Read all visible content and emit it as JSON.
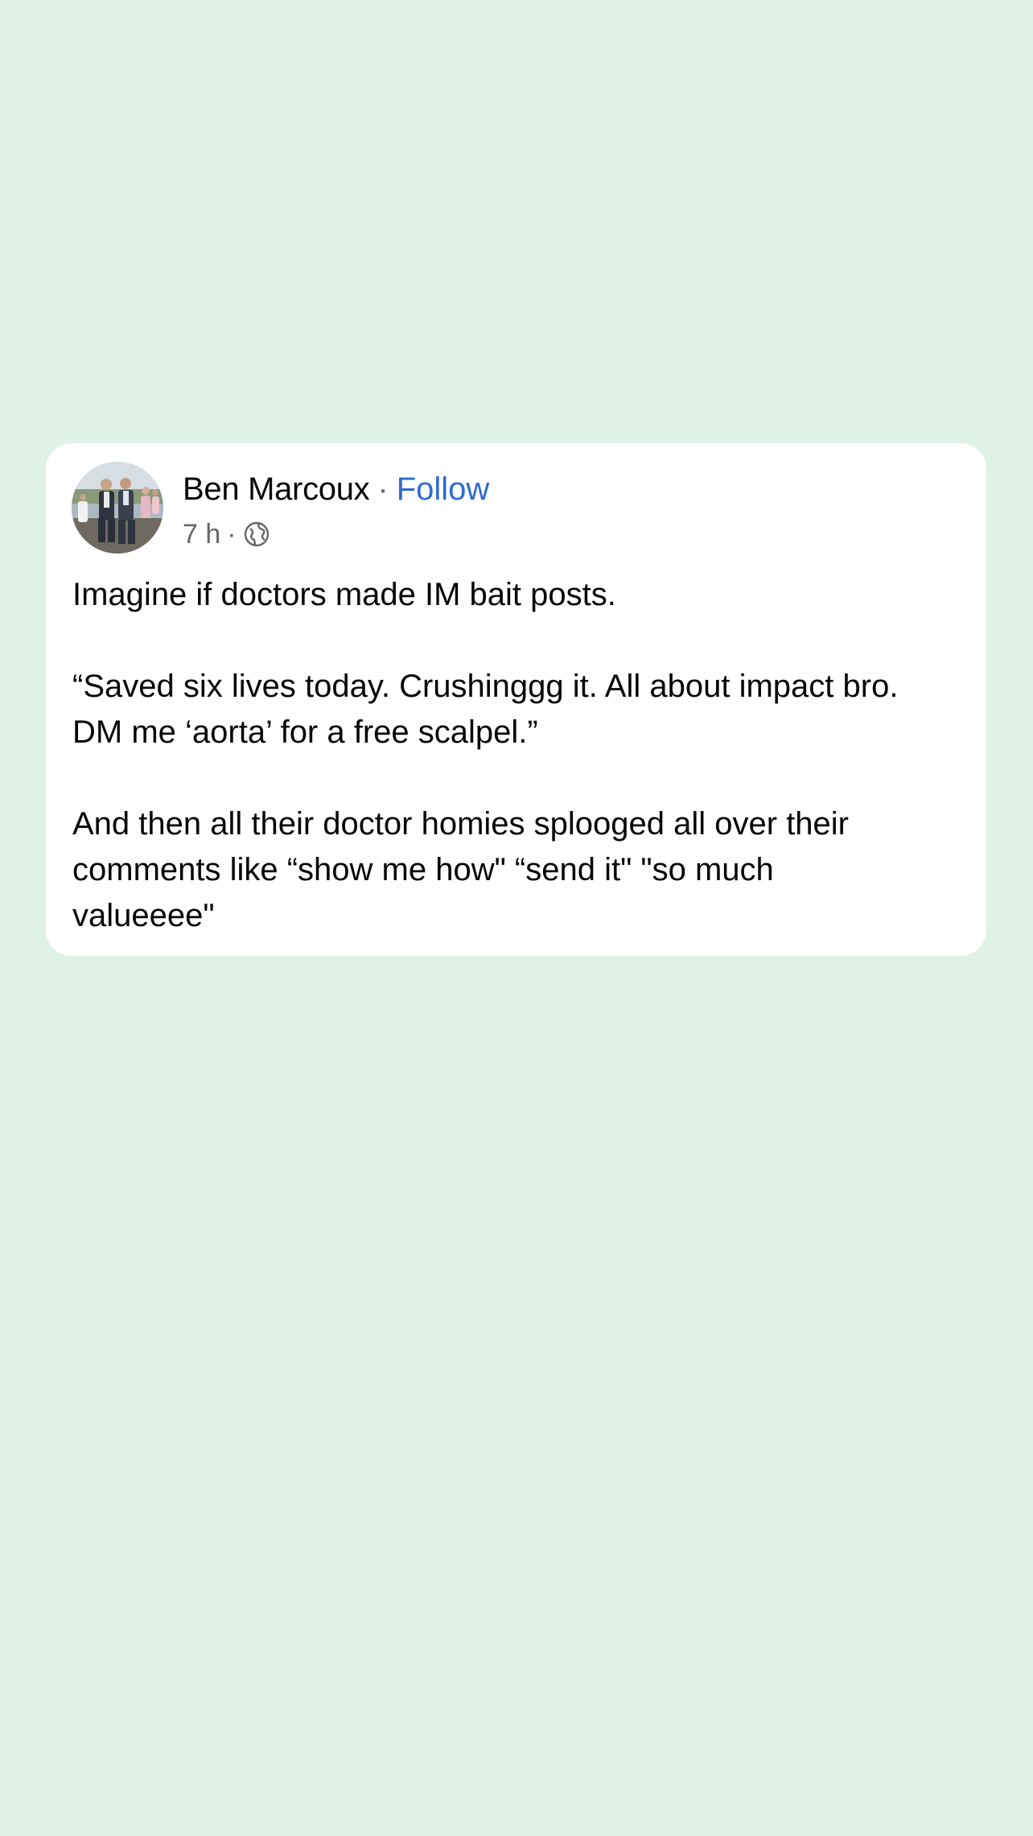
{
  "post": {
    "author": "Ben Marcoux",
    "separator": "·",
    "follow_label": "Follow",
    "time": "7 h",
    "meta_separator": "·",
    "privacy_icon": "globe-icon",
    "paragraphs": [
      "Imagine if doctors made IM bait posts.",
      "“Saved six lives today. Crushinggg it. All about impact bro.\nDM me ‘aorta’ for a free scalpel.”",
      "And then all their doctor homies splooged all over their\ncomments like “show me how\" “send it\" \"so much\nvalueeee\""
    ]
  },
  "colors": {
    "background": "#dff2e7",
    "card": "#ffffff",
    "text": "#050505",
    "secondary_text": "#65676b",
    "link": "#2d6bd0"
  }
}
